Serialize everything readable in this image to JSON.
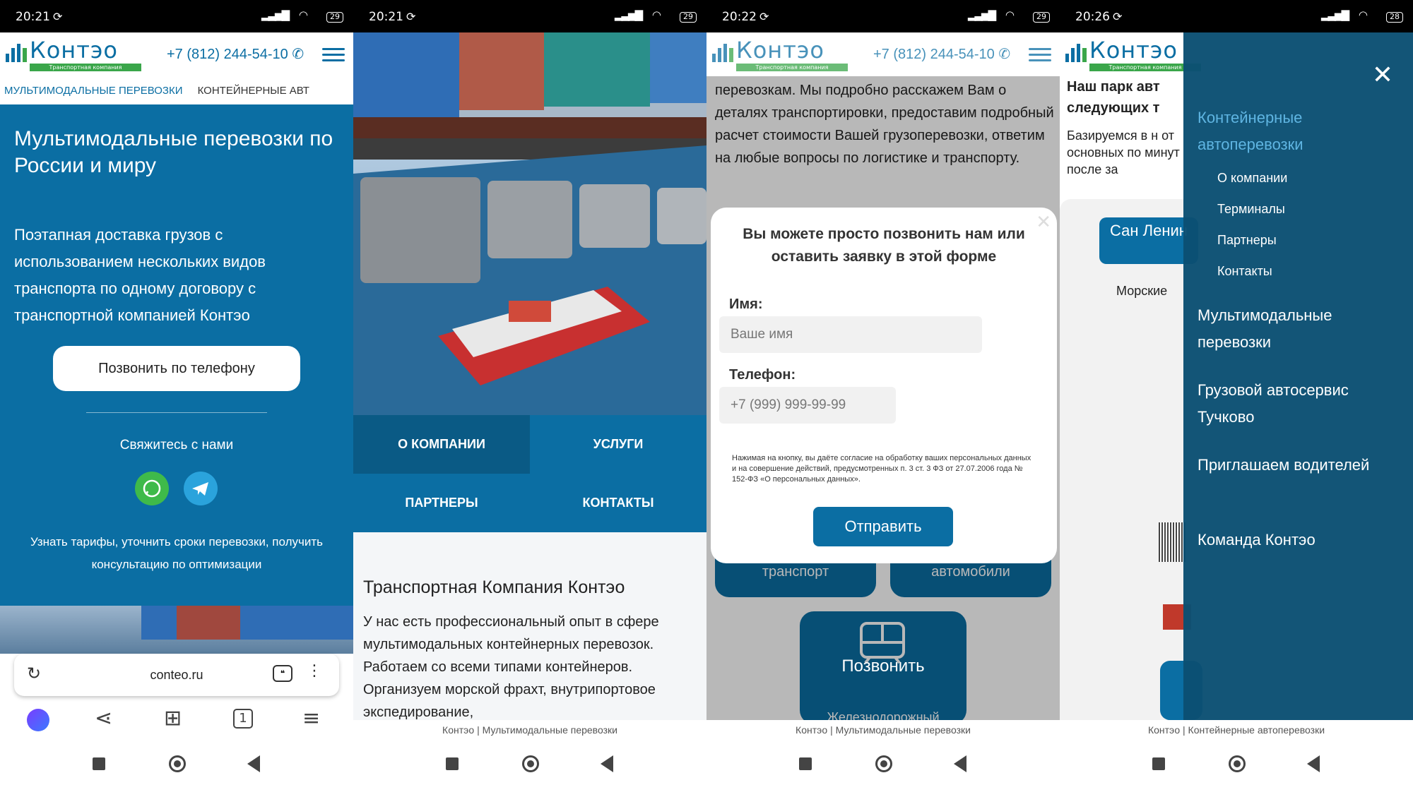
{
  "colors": {
    "brand": "#0b6ea3",
    "accent_green": "#3aa64a",
    "whatsapp": "#3fba4a",
    "telegram": "#2aa3dc"
  },
  "status_bar": {
    "times": [
      "20:21",
      "20:21",
      "20:22",
      "20:26"
    ],
    "battery": [
      "29",
      "29",
      "29",
      "28"
    ]
  },
  "header": {
    "logo": "Контэо",
    "logo_sub": "Транспортная компания",
    "phone": "+7 (812) 244-54-10"
  },
  "screen1": {
    "nav_items": [
      "МУЛЬТИМОДАЛЬНЫЕ ПЕРЕВОЗКИ",
      "КОНТЕЙНЕРНЫЕ АВТ"
    ],
    "hero_title": "Мультимодальные перевозки по России и миру",
    "hero_desc": "Поэтапная доставка грузов с использованием нескольких видов транспорта по одному договору с транспортной компанией Контэо",
    "call_button": "Позвонить по телефону",
    "contact_label": "Свяжитесь с нами",
    "bottom_text": "Узнать тарифы, уточнить сроки перевозки, получить консультацию по оптимизации",
    "url": "conteo.ru",
    "tabs_count": "1"
  },
  "screen2": {
    "menu": [
      "О КОМПАНИИ",
      "УСЛУГИ",
      "ПАРТНЕРЫ",
      "КОНТАКТЫ"
    ],
    "section_title": "Транспортная Компания Контэо",
    "section_text": "У нас есть профессиональный опыт в сфере мультимодальных контейнерных перевозок. Работаем со всеми типами контейнеров. Организуем морской фрахт, внутрипортовое экспедирование,",
    "caption": "Контэо | Мультимодальные перевозки"
  },
  "screen3": {
    "bg_text": "перевозкам. Мы подробно расскажем Вам о деталях транспортировки, предоставим подробный расчет стоимости Вашей грузоперевозки, ответим на любые вопросы по логистике и транспорту.",
    "modal_title": "Вы можете просто позвонить нам или оставить заявку в этой форме",
    "name_label": "Имя:",
    "name_placeholder": "Ваше имя",
    "phone_label": "Телефон:",
    "phone_placeholder": "+7 (999) 999-99-99",
    "consent": "Нажимая на кнопку, вы даёте согласие на обработку ваших персональных данных и на совершение действий, предусмотренных п. 3 ст. 3 ФЗ от 27.07.2006 года № 152-ФЗ «О персональных данных».",
    "submit": "Отправить",
    "tile_left": "транспорт",
    "tile_right": "автомобили",
    "tile_bottom": "Железнодорожный",
    "call_float": "Позвонить",
    "caption": "Контэо | Мультимодальные перевозки"
  },
  "screen4": {
    "bg_title": "Наш парк авт следующих т",
    "bg_text": "Базируемся в н от основных по минут после за",
    "bg_button": "Сан Ленин",
    "bg_label": "Морские",
    "drawer_items": [
      {
        "label": "Контейнерные автоперевозки",
        "type": "active"
      },
      {
        "label": "О компании",
        "type": "sub"
      },
      {
        "label": "Терминалы",
        "type": "sub"
      },
      {
        "label": "Партнеры",
        "type": "sub"
      },
      {
        "label": "Контакты",
        "type": "sub"
      },
      {
        "label": "Мультимодальные перевозки",
        "type": "main"
      },
      {
        "label": "Грузовой автосервис Тучково",
        "type": "main"
      },
      {
        "label": "Приглашаем водителей",
        "type": "main"
      },
      {
        "label": "Команда Контэо",
        "type": "main"
      }
    ],
    "caption": "Контэо | Контейнерные автоперевозки"
  }
}
